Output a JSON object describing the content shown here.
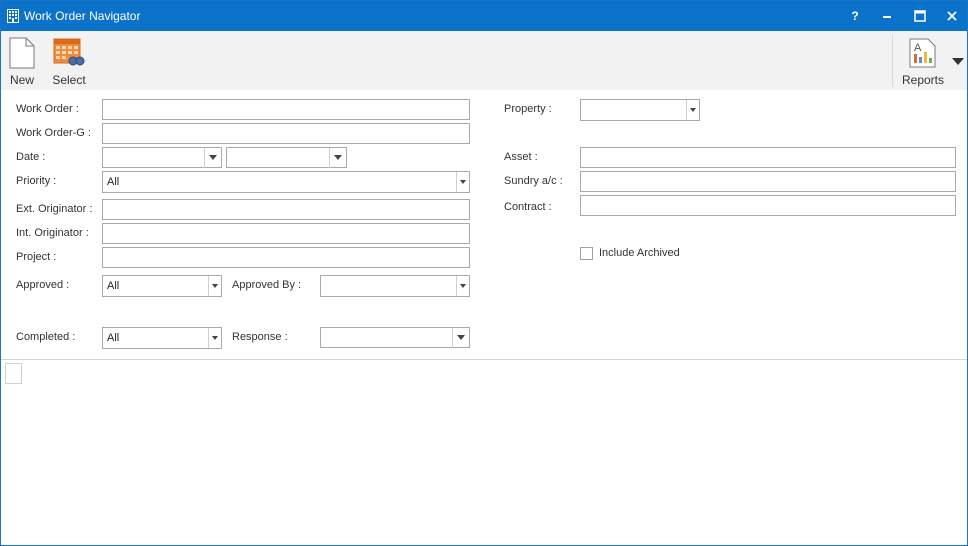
{
  "window": {
    "title": "Work Order Navigator",
    "title_buttons": {
      "help": "?",
      "minimize": "–",
      "maximize": "☐",
      "close": "✕"
    }
  },
  "toolbar": {
    "new_label": "New",
    "select_label": "Select",
    "reports_label": "Reports"
  },
  "form": {
    "work_order_label": "Work Order :",
    "work_order_g_label": "Work Order-G :",
    "date_label": "Date :",
    "priority_label": "Priority :",
    "priority_value": "All",
    "ext_originator_label": "Ext. Originator :",
    "int_originator_label": "Int. Originator :",
    "project_label": "Project :",
    "approved_label": "Approved :",
    "approved_value": "All",
    "approved_by_label": "Approved By :",
    "completed_label": "Completed :",
    "completed_value": "All",
    "response_label": "Response :",
    "property_label": "Property :",
    "asset_label": "Asset :",
    "sundry_label": "Sundry a/c :",
    "contract_label": "Contract :",
    "include_archived_label": "Include Archived"
  },
  "colors": {
    "titlebar": "#0a73c9",
    "toolbar_bg": "#f2f2f2"
  }
}
